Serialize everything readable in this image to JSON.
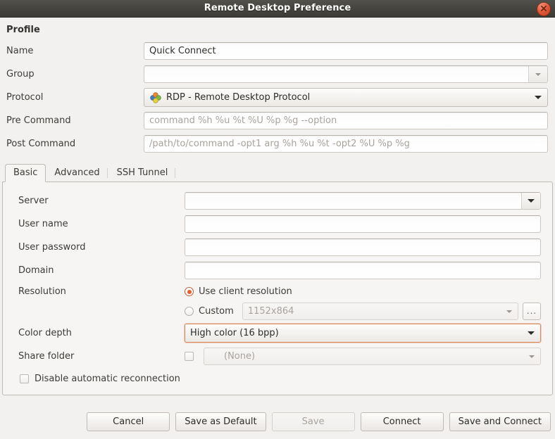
{
  "window": {
    "title": "Remote Desktop Preference",
    "close_icon": "close-icon"
  },
  "profile": {
    "section_title": "Profile",
    "fields": [
      {
        "label": "Name",
        "value": "Quick Connect",
        "placeholder": "",
        "kind": "entry"
      },
      {
        "label": "Group",
        "value": "",
        "placeholder": "",
        "kind": "combo-entry"
      },
      {
        "label": "Protocol",
        "value": "RDP - Remote Desktop Protocol",
        "placeholder": "",
        "kind": "combo",
        "icon": "rdp-protocol-icon"
      },
      {
        "label": "Pre Command",
        "value": "",
        "placeholder": "command %h %u %t %U %p %g --option",
        "kind": "entry"
      },
      {
        "label": "Post Command",
        "value": "",
        "placeholder": "/path/to/command -opt1 arg %h %u %t -opt2 %U %p %g",
        "kind": "entry"
      }
    ]
  },
  "tabs": [
    {
      "label": "Basic",
      "active": true
    },
    {
      "label": "Advanced",
      "active": false
    },
    {
      "label": "SSH Tunnel",
      "active": false
    }
  ],
  "basic": {
    "server": {
      "label": "Server",
      "value": ""
    },
    "user_name": {
      "label": "User name",
      "value": ""
    },
    "user_password": {
      "label": "User password",
      "value": ""
    },
    "domain": {
      "label": "Domain",
      "value": ""
    },
    "resolution": {
      "label": "Resolution",
      "use_client_label": "Use client resolution",
      "use_client_selected": true,
      "custom_label": "Custom",
      "custom_selected": false,
      "custom_value": "1152x864",
      "browse_label": "..."
    },
    "color_depth": {
      "label": "Color depth",
      "value": "High color (16 bpp)",
      "focused": true
    },
    "share_folder": {
      "label": "Share folder",
      "checked": false,
      "value": "(None)"
    },
    "disable_reconnect": {
      "label": "Disable automatic reconnection",
      "checked": false
    }
  },
  "buttons": [
    {
      "label": "Cancel",
      "disabled": false
    },
    {
      "label": "Save as Default",
      "disabled": false
    },
    {
      "label": "Save",
      "disabled": true
    },
    {
      "label": "Connect",
      "disabled": false
    },
    {
      "label": "Save and Connect",
      "disabled": false
    }
  ],
  "colors": {
    "titlebar": "#46453f",
    "window_bg": "#f2f1f0",
    "panel_bg": "#f6f5f4",
    "accent_orange": "#e2622f",
    "focus_border": "#d98a5d",
    "text": "#3c3b37",
    "placeholder_text": "#a8a39d",
    "close_button": "#e2593a"
  }
}
